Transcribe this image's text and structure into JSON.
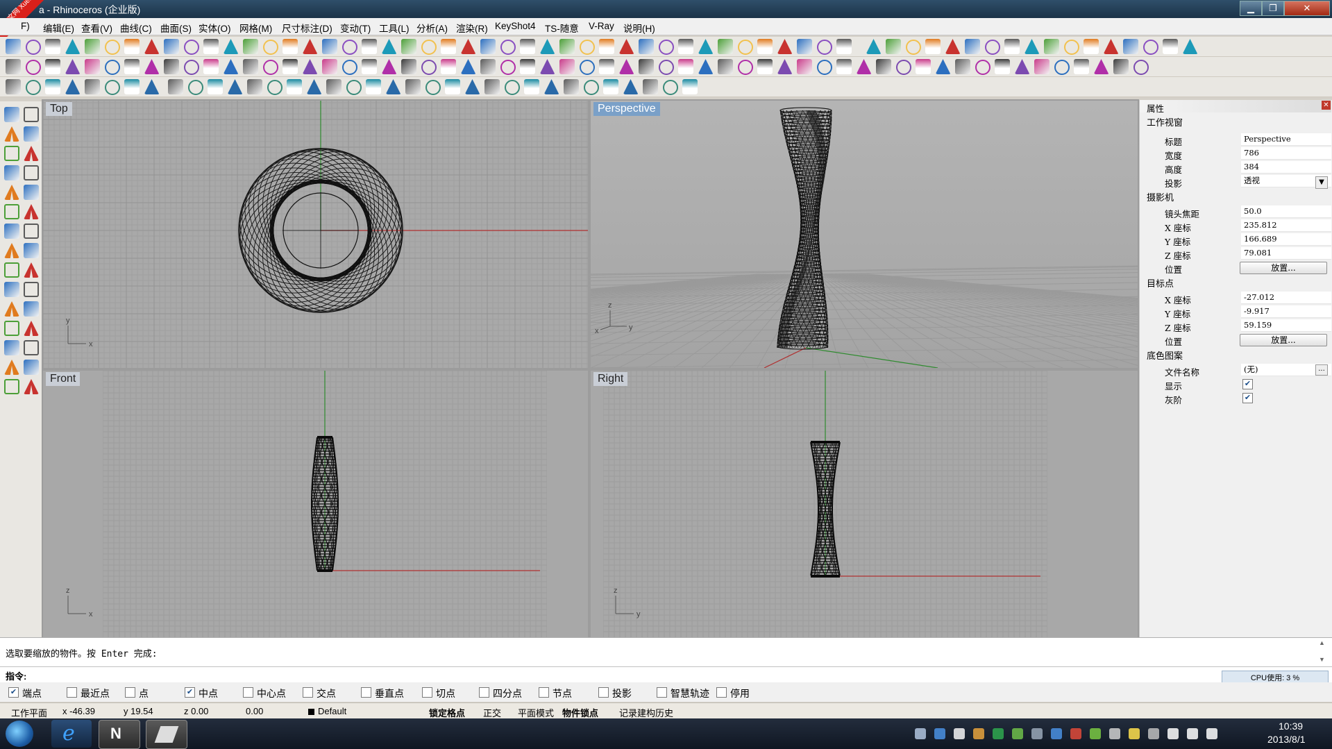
{
  "window": {
    "title": "a - Rhinoceros (企业版)",
    "minimize": "▁",
    "maximize": "❐",
    "close": "✕"
  },
  "ribbon": "学犀牛中文网 XueXiniu",
  "menu": [
    "F)",
    "编辑(E)",
    "查看(V)",
    "曲线(C)",
    "曲面(S)",
    "实体(O)",
    "网格(M)",
    "尺寸标注(D)",
    "变动(T)",
    "工具(L)",
    "分析(A)",
    "渲染(R)",
    "KeyShot4",
    "TS-随意",
    "V-Ray",
    "说明(H)"
  ],
  "viewports": {
    "top": {
      "label": "Top",
      "axis_x": "x",
      "axis_y": "y"
    },
    "perspective": {
      "label": "Perspective",
      "axis_x": "y",
      "axis_y": "z",
      "axis_o": "x"
    },
    "front": {
      "label": "Front",
      "axis_x": "x",
      "axis_y": "z"
    },
    "right": {
      "label": "Right",
      "axis_x": "y",
      "axis_y": "z"
    }
  },
  "props": {
    "title": "属性",
    "close": "✕",
    "section_viewport": "工作视窗",
    "rows_viewport": [
      {
        "k": "标题",
        "v": "Perspective"
      },
      {
        "k": "宽度",
        "v": "786"
      },
      {
        "k": "高度",
        "v": "384"
      },
      {
        "k": "投影",
        "v": "透视"
      }
    ],
    "section_camera": "摄影机",
    "rows_camera": [
      {
        "k": "镜头焦距",
        "v": "50.0"
      },
      {
        "k": "X 座标",
        "v": "235.812"
      },
      {
        "k": "Y 座标",
        "v": "166.689"
      },
      {
        "k": "Z 座标",
        "v": "79.081"
      }
    ],
    "camera_pos_label": "位置",
    "place_button": "放置...",
    "section_target": "目标点",
    "rows_target": [
      {
        "k": "X 座标",
        "v": "-27.012"
      },
      {
        "k": "Y 座标",
        "v": "-9.917"
      },
      {
        "k": "Z 座标",
        "v": "59.159"
      }
    ],
    "target_pos_label": "位置",
    "place_button2": "放置...",
    "section_bg": "底色图案",
    "file_name_label": "文件名称",
    "file_name_value": "(无)",
    "browse": "...",
    "show_label": "显示",
    "gray_label": "灰阶",
    "cpu": "CPU使用: 3 %"
  },
  "command": {
    "history": "选取要缩放的物件。按 Enter 完成:",
    "prompt": "指令:",
    "scroll_up": "▲",
    "scroll_down": "▼"
  },
  "osnaps": [
    {
      "label": "端点",
      "checked": true
    },
    {
      "label": "最近点",
      "checked": false
    },
    {
      "label": "点",
      "checked": false
    },
    {
      "label": "中点",
      "checked": true
    },
    {
      "label": "中心点",
      "checked": false
    },
    {
      "label": "交点",
      "checked": false
    },
    {
      "label": "垂直点",
      "checked": false
    },
    {
      "label": "切点",
      "checked": false
    },
    {
      "label": "四分点",
      "checked": false
    },
    {
      "label": "节点",
      "checked": false
    },
    {
      "label": "投影",
      "checked": false
    },
    {
      "label": "智慧轨迹",
      "checked": false
    },
    {
      "label": "停用",
      "checked": false
    }
  ],
  "status": {
    "plane": "工作平面",
    "x": "x -46.39",
    "y": "y 19.54",
    "z": "z 0.00",
    "dist": "0.00",
    "layer": "Default",
    "grid_snap": "锁定格点",
    "ortho": "正交",
    "planar": "平面模式",
    "osnap": "物件锁点",
    "history": "记录建构历史"
  },
  "taskbar": {
    "time": "10:39",
    "date": "2013/8/1"
  },
  "colors": {
    "accent": "#7aa0c8",
    "xaxis": "#b03030",
    "yaxis": "#2e8b2e",
    "viewport_bg": "#a8a8a8"
  },
  "icons": [
    "new-icon",
    "open-icon",
    "save-icon",
    "print-icon",
    "cut-icon",
    "copy-icon",
    "paste-icon",
    "undo-icon",
    "pan-icon",
    "zoom-icon",
    "render-icon",
    "help-icon"
  ]
}
